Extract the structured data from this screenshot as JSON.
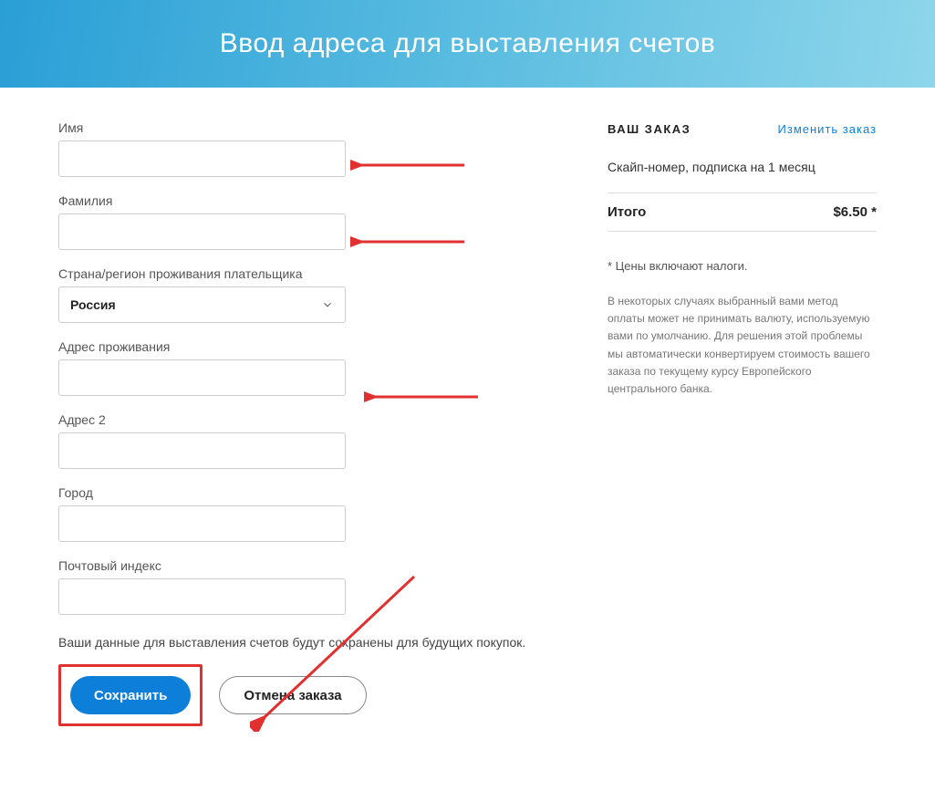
{
  "header": {
    "title": "Ввод адреса для выставления счетов"
  },
  "form": {
    "first_name_label": "Имя",
    "last_name_label": "Фамилия",
    "country_label": "Страна/регион проживания плательщика",
    "country_value": "Россия",
    "address_label": "Адрес проживания",
    "address2_label": "Адрес 2",
    "city_label": "Город",
    "postal_label": "Почтовый индекс",
    "note": "Ваши данные для выставления счетов будут сохранены для будущих покупок.",
    "save_label": "Сохранить",
    "cancel_label": "Отмена заказа"
  },
  "order": {
    "heading": "ВАШ ЗАКАЗ",
    "change_link": "Изменить заказ",
    "item": "Скайп-номер, подписка на 1 месяц",
    "total_label": "Итого",
    "total_value": "$6.50 *",
    "tax_note": "* Цены включают налоги.",
    "disclaimer": "В некоторых случаях выбранный вами метод оплаты может не принимать валюту, используемую вами по умолчанию. Для решения этой проблемы мы автоматически конвертируем стоимость вашего заказа по текущему курсу Европейского центрального банка."
  }
}
